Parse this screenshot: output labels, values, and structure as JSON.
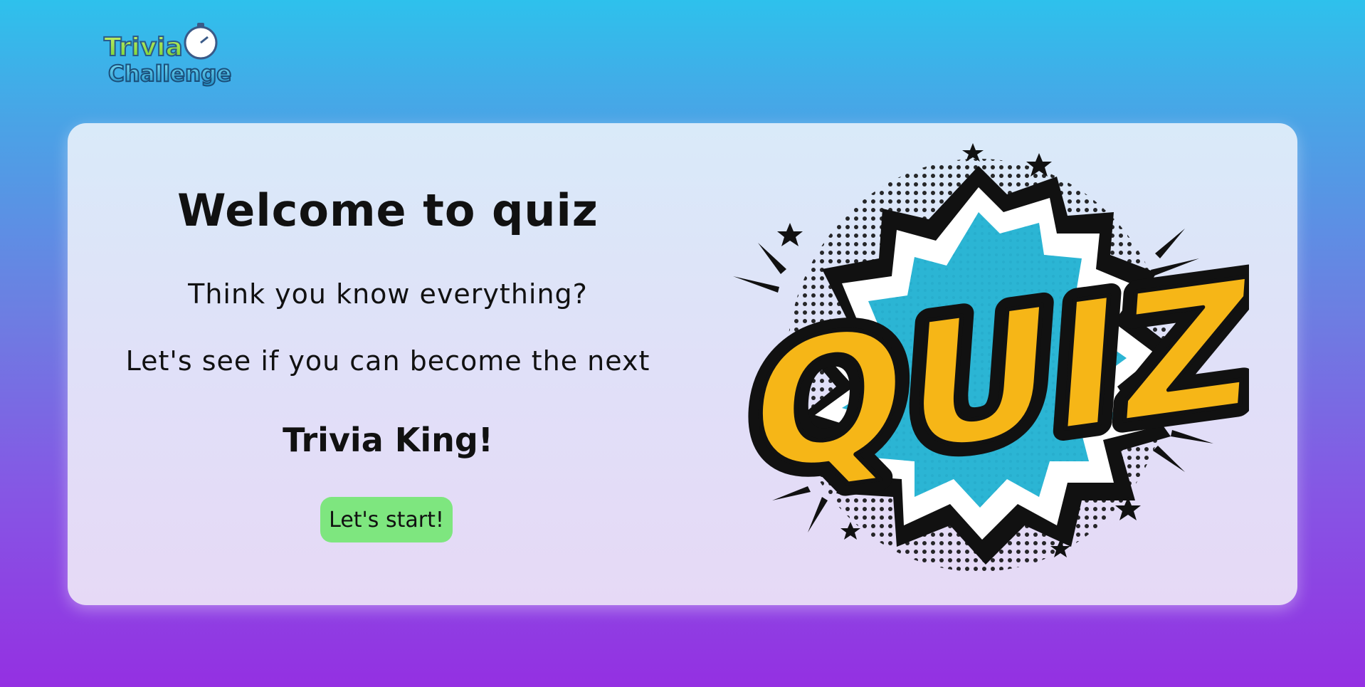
{
  "logo": {
    "line1": "Trivia",
    "line2": "Challenge",
    "icon": "stopwatch-icon"
  },
  "card": {
    "title": "Welcome to quiz",
    "line1": "Think you know everything?",
    "line2": "Let's see if you can become the next",
    "king": "Trivia King!",
    "start_label": "Let's start!"
  },
  "art": {
    "text": "QUIZ!",
    "colors": {
      "letters": "#f6b617",
      "burst": "#2bb5d4",
      "outline": "#111111"
    }
  },
  "colors": {
    "bg_top": "#2ec1ec",
    "bg_bottom": "#9430e2",
    "button": "#7ee67f"
  }
}
